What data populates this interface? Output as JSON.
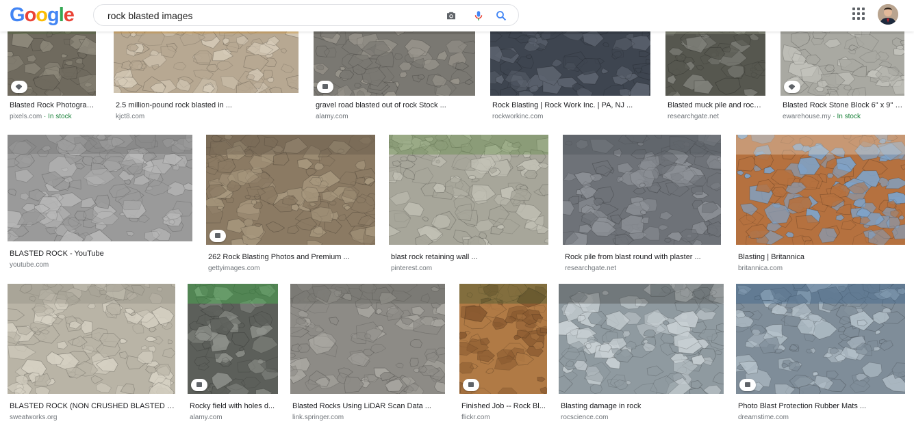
{
  "header": {
    "logo": [
      "G",
      "o",
      "o",
      "g",
      "l",
      "e"
    ],
    "logo_colors": [
      "#4285F4",
      "#EA4335",
      "#FBBC05",
      "#4285F4",
      "#34A853",
      "#EA4335"
    ],
    "search_value": "rock blasted images"
  },
  "results": [
    {
      "title": "Blasted Rock Photograp ...",
      "source": "pixels.com",
      "extra": " · In stock",
      "icon": "tag-icon",
      "palette": [
        "#6f6a5e",
        "#8f8a7c",
        "#4f6b3a"
      ]
    },
    {
      "title": "2.5 million-pound rock blasted in ...",
      "source": "kjct8.com",
      "extra": "",
      "icon": "",
      "palette": [
        "#b7a892",
        "#d6cbb8",
        "#e8a030"
      ]
    },
    {
      "title": "gravel road blasted out of rock Stock ...",
      "source": "alamy.com",
      "extra": "",
      "icon": "image-icon",
      "palette": [
        "#7a7872",
        "#9b978e",
        "#55534e"
      ]
    },
    {
      "title": "Rock Blasting | Rock Work Inc. | PA, NJ ...",
      "source": "rockworkinc.com",
      "extra": "",
      "icon": "",
      "palette": [
        "#3e4550",
        "#5d6470",
        "#2b3038"
      ]
    },
    {
      "title": "Blasted muck pile and rock ...",
      "source": "researchgate.net",
      "extra": "",
      "icon": "",
      "palette": [
        "#56574f",
        "#80817a",
        "#9aa08a"
      ]
    },
    {
      "title": "Blasted Rock Stone Block 6\" x 9\" (...",
      "source": "ewarehouse.my",
      "extra": " · In stock",
      "icon": "tag-icon",
      "palette": [
        "#a9a9a2",
        "#c4c4bd",
        "#8d8d86"
      ]
    },
    {
      "title": "BLASTED ROCK - YouTube",
      "source": "youtube.com",
      "extra": "",
      "icon": "",
      "palette": [
        "#9a9a9a",
        "#b8b8b8",
        "#6e6e6e"
      ]
    },
    {
      "title": "262 Rock Blasting Photos and Premium ...",
      "source": "gettyimages.com",
      "extra": "",
      "icon": "image-icon",
      "palette": [
        "#8b7a63",
        "#a8987e",
        "#5f5444"
      ]
    },
    {
      "title": "blast rock retaining wall ...",
      "source": "pinterest.com",
      "extra": "",
      "icon": "",
      "palette": [
        "#a7a69a",
        "#c3c2b6",
        "#5a8a3a"
      ]
    },
    {
      "title": "Rock pile from blast round with plaster ...",
      "source": "researchgate.net",
      "extra": "",
      "icon": "",
      "palette": [
        "#6e7278",
        "#8e9298",
        "#4b4f55"
      ]
    },
    {
      "title": "Blasting | Britannica",
      "source": "britannica.com",
      "extra": "",
      "icon": "",
      "palette": [
        "#b5713f",
        "#7fa3c9",
        "#e7e2d8"
      ]
    },
    {
      "title": "BLASTED ROCK (NON CRUSHED BLASTED RO...",
      "source": "sweatworks.org",
      "extra": "",
      "icon": "",
      "palette": [
        "#b9b4a6",
        "#d6d1c3",
        "#8d897e"
      ]
    },
    {
      "title": "Rocky field with holes d...",
      "source": "alamy.com",
      "extra": "",
      "icon": "image-icon",
      "palette": [
        "#5c5f5a",
        "#8e918b",
        "#3fcf4a"
      ]
    },
    {
      "title": "Blasted Rocks Using LiDAR Scan Data ...",
      "source": "link.springer.com",
      "extra": "",
      "icon": "",
      "palette": [
        "#8d8b86",
        "#a9a7a1",
        "#5d5b57"
      ]
    },
    {
      "title": "Finished Job -- Rock Bl...",
      "source": "flickr.com",
      "extra": "",
      "icon": "image-icon",
      "palette": [
        "#b07a45",
        "#8a5a30",
        "#2f5a30"
      ]
    },
    {
      "title": "Blasting damage in rock",
      "source": "rocscience.com",
      "extra": "",
      "icon": "",
      "palette": [
        "#8f9aa0",
        "#c8d0d4",
        "#3a3a36"
      ]
    },
    {
      "title": "Photo Blast Protection Rubber Mats ...",
      "source": "dreamstime.com",
      "extra": "",
      "icon": "image-icon",
      "palette": [
        "#7f8d99",
        "#b6c3cc",
        "#2d5b8a"
      ]
    }
  ]
}
